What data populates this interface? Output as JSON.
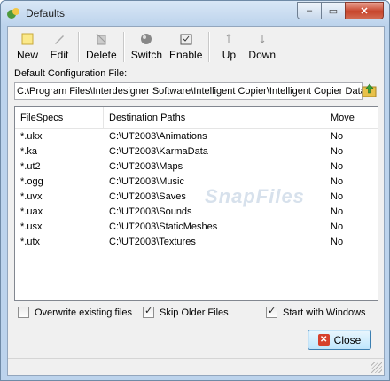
{
  "window": {
    "title": "Defaults"
  },
  "toolbar": {
    "new_label": "New",
    "edit_label": "Edit",
    "delete_label": "Delete",
    "switch_label": "Switch",
    "enable_label": "Enable",
    "up_label": "Up",
    "down_label": "Down"
  },
  "config": {
    "label": "Default Configuration File:",
    "value": "C:\\Program Files\\Interdesigner Software\\Intelligent Copier\\Intelligent Copier Data"
  },
  "table": {
    "columns": [
      "FileSpecs",
      "Destination Paths",
      "Move"
    ],
    "rows": [
      [
        "*.ukx",
        "C:\\UT2003\\Animations",
        "No"
      ],
      [
        "*.ka",
        "C:\\UT2003\\KarmaData",
        "No"
      ],
      [
        "*.ut2",
        "C:\\UT2003\\Maps",
        "No"
      ],
      [
        "*.ogg",
        "C:\\UT2003\\Music",
        "No"
      ],
      [
        "*.uvx",
        "C:\\UT2003\\Saves",
        "No"
      ],
      [
        "*.uax",
        "C:\\UT2003\\Sounds",
        "No"
      ],
      [
        "*.usx",
        "C:\\UT2003\\StaticMeshes",
        "No"
      ],
      [
        "*.utx",
        "C:\\UT2003\\Textures",
        "No"
      ]
    ]
  },
  "options": {
    "overwrite_label": "Overwrite existing files",
    "overwrite_checked": false,
    "skip_older_label": "Skip Older Files",
    "skip_older_checked": true,
    "start_windows_label": "Start with Windows",
    "start_windows_checked": true
  },
  "buttons": {
    "close_label": "Close"
  },
  "watermark": "SnapFiles",
  "colors": {
    "accent": "#3c7fb1",
    "close_red": "#d6402c",
    "titlebar": "#bcd3ec"
  },
  "icons": [
    "app-icon",
    "new-icon",
    "edit-icon",
    "delete-icon",
    "switch-icon",
    "enable-icon",
    "up-icon",
    "down-icon",
    "browse-folder-icon",
    "close-icon"
  ]
}
